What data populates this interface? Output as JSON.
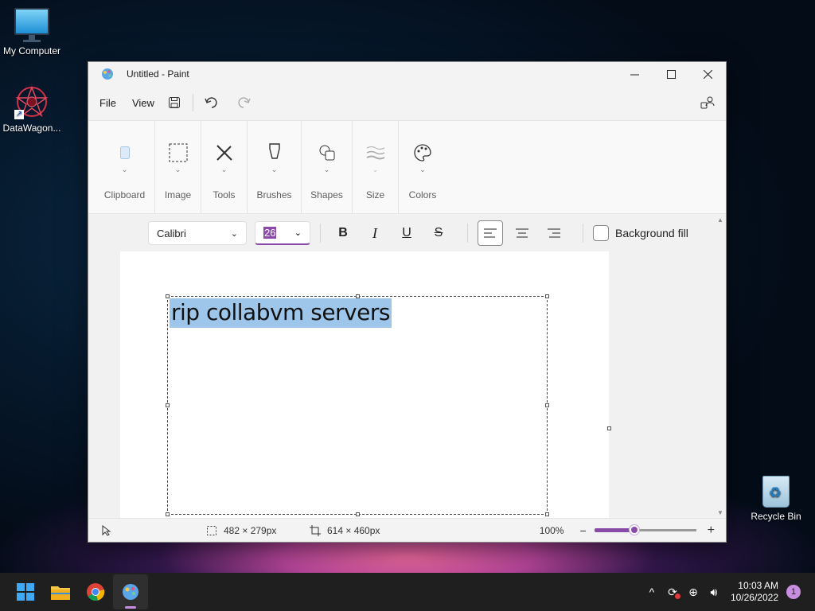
{
  "desktop": {
    "icons": [
      {
        "label": "My Computer"
      },
      {
        "label": "DataWagon..."
      },
      {
        "label": "Recycle Bin"
      }
    ]
  },
  "window": {
    "title": "Untitled - Paint",
    "menu": {
      "file": "File",
      "view": "View"
    },
    "ribbon": {
      "groups": [
        "Clipboard",
        "Image",
        "Tools",
        "Brushes",
        "Shapes",
        "Size",
        "Colors"
      ]
    },
    "text_toolbar": {
      "font": "Calibri",
      "font_size": "26",
      "background_fill_label": "Background fill"
    },
    "canvas": {
      "text": "rip collabvm servers"
    },
    "status": {
      "selection_size": "482 × 279px",
      "canvas_size": "614 × 460px",
      "zoom": "100%",
      "zoom_level": 0.39
    }
  },
  "taskbar": {
    "apps": [
      "start-icon",
      "file-explorer-icon",
      "chrome-icon",
      "paint-icon"
    ],
    "time": "10:03 AM",
    "date": "10/26/2022",
    "notification_count": "1"
  },
  "colors": {
    "accent": "#8a4aa9",
    "selection_highlight": "#9ec6ea"
  }
}
